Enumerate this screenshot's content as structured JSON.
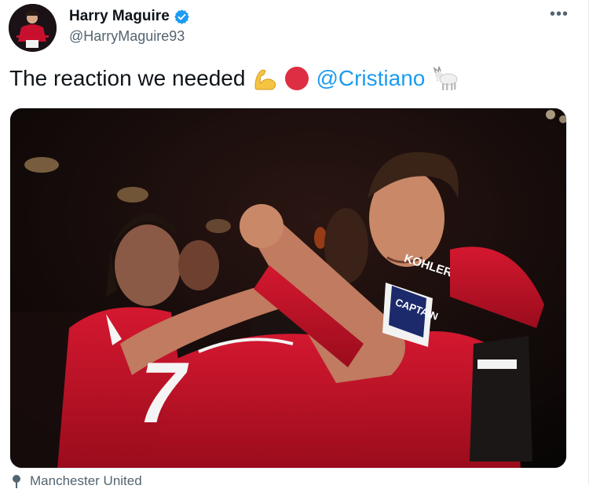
{
  "tweet": {
    "display_name": "Harry Maguire",
    "handle": "@HarryMaguire93",
    "text": "The reaction we needed",
    "mention": "@Cristiano",
    "emojis": [
      "flexed-biceps",
      "red-circle",
      "goat"
    ],
    "verified": true,
    "more_label": "•••",
    "location": "Manchester United"
  },
  "photo": {
    "jersey_number": "7",
    "sponsor_text": "KOHLER",
    "sleeve_badge": "CAPTAIN"
  },
  "colors": {
    "verified_blue": "#1d9bf0",
    "link_blue": "#1d9bf0",
    "kit_red": "#c8102e",
    "text_primary": "#0f1419",
    "text_secondary": "#536471"
  }
}
